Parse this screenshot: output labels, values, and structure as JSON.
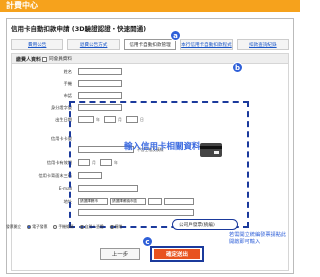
{
  "header": {
    "title": "計費中心"
  },
  "panel": {
    "title": "信用卡自動扣款申請 (3D驗證認證・快速開通)"
  },
  "tabs": [
    {
      "label": "費用公告"
    },
    {
      "label": "退費公告方式"
    },
    {
      "label": "信用卡自動扣款管理"
    },
    {
      "label": "本行信用卡自動扣款程式"
    },
    {
      "label": "扣款查詢紀錄"
    }
  ],
  "form": {
    "section_label": "繳費人資料",
    "same_as_member_label": "同會員資料",
    "fields": [
      {
        "label": "姓名"
      },
      {
        "label": "手機"
      },
      {
        "label": "市話"
      },
      {
        "label": "身分證字號"
      },
      {
        "label": "出生日期",
        "unit_year": "年",
        "unit_month": "月",
        "unit_day": "日"
      },
      {
        "label": "信用卡卡號",
        "note": "不含空格及橫線"
      },
      {
        "label": "信用卡有效期",
        "unit_month": "月",
        "unit_year": "年"
      },
      {
        "label": "信用卡背面末三碼"
      },
      {
        "label": "E-mail"
      },
      {
        "label": "地址",
        "select_city": "請選擇縣市",
        "select_district": "請選擇鄉鎮市區"
      }
    ],
    "radio_label": "發票開立",
    "radio_options": [
      "電子發票",
      "手機條碼",
      "自然人憑證",
      "捐贈"
    ],
    "highlight_option": "公司戶發票(統編)"
  },
  "annotations": {
    "badge_a": "a",
    "badge_b": "b",
    "badge_c": "c",
    "overlay": "輸入信用卡相關資料",
    "tip": "若需開立統編發票請點此開啟即可輸入"
  },
  "buttons": {
    "back": "上一步",
    "submit": "確定送出"
  },
  "colors": {
    "header": "#f6a21c",
    "accent_blue": "#2e5fd8",
    "submit": "#e8531f"
  }
}
